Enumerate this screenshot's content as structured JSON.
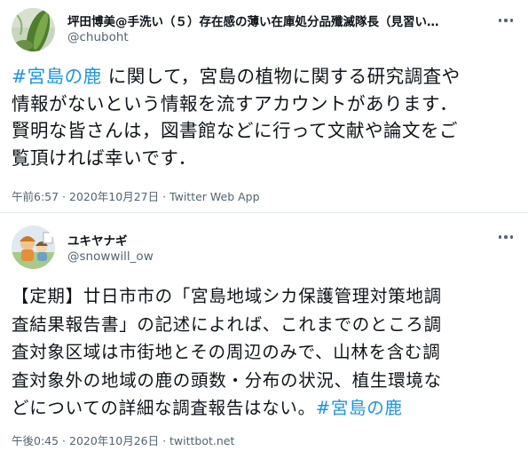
{
  "tweets": [
    {
      "display_name": "坪田博美@手洗い（５）存在感の薄い在庫処分品殲滅隊長（見習い…",
      "handle": "@chuboht",
      "body_lines": [
        {
          "hashtag": "#宮島の鹿",
          "text": " に関して，宮島の植物に関する研究調査や"
        },
        {
          "hashtag": "",
          "text": "情報がないという情報を流すアカウントがあります．"
        },
        {
          "hashtag": "",
          "text": "賢明な皆さんは，図書館などに行って文献や論文をご"
        },
        {
          "hashtag": "",
          "text": "覧頂ければ幸いです．"
        }
      ],
      "timestamp": "午前6:57 · 2020年10月27日 · Twitter Web App"
    },
    {
      "display_name": "ユキヤナギ",
      "handle": "@snowwill_ow",
      "body_lines": [
        {
          "text": "【定期】廿日市市の「宮島地域シカ保護管理対策地調",
          "hashtag": ""
        },
        {
          "text": "査結果報告書」の記述によれば、これまでのところ調",
          "hashtag": ""
        },
        {
          "text": "査対象区域は市街地とその周辺のみで、山林を含む調",
          "hashtag": ""
        },
        {
          "text": "査対象外の地域の鹿の頭数・分布の状況、植生環境な",
          "hashtag": ""
        },
        {
          "text": "どについての詳細な調査報告はない。",
          "hashtag": "#宮島の鹿"
        }
      ],
      "timestamp": "午後0:45 · 2020年10月26日 · twittbot.net"
    }
  ],
  "colors": {
    "hashtag": "#1b95e0",
    "secondary_text": "#536471",
    "divider": "#e1e8ed"
  },
  "icons": [
    "more-options-icon",
    "avatar-plant-photo",
    "avatar-illustration"
  ]
}
